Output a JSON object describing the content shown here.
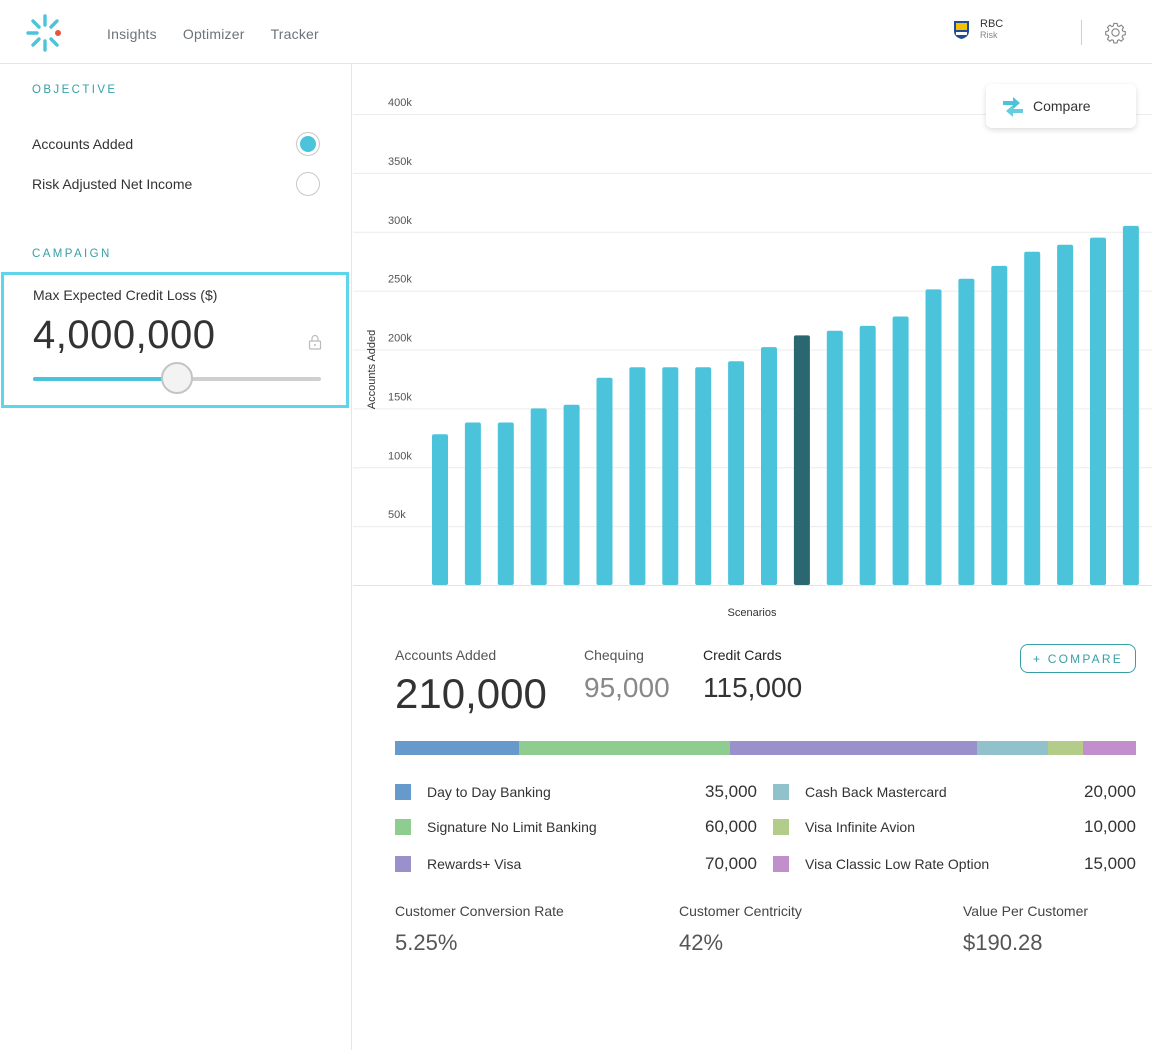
{
  "nav": {
    "items": [
      "Insights",
      "Optimizer",
      "Tracker"
    ]
  },
  "org": {
    "name": "RBC",
    "role": "Risk"
  },
  "icons": {
    "logo": "sparkle-logo",
    "org_logo": "rbc-shield-logo",
    "settings": "gear-icon",
    "lock": "lock-icon",
    "compare": "swap-arrows-icon"
  },
  "colors": {
    "accent": "#4bc3da",
    "accent_dark": "#2b6770",
    "teal_text": "#35a0a7"
  },
  "sidebar": {
    "objective_title": "OBJECTIVE",
    "objectives": [
      {
        "label": "Accounts Added",
        "selected": true
      },
      {
        "label": "Risk Adjusted Net Income",
        "selected": false
      }
    ],
    "campaign_title": "CAMPAIGN",
    "campaign": {
      "label": "Max Expected Credit Loss ($)",
      "value": "4,000,000",
      "slider_fraction": 0.5
    }
  },
  "compare_card": {
    "label": "Compare"
  },
  "chart_data": {
    "type": "bar",
    "ylabel": "Accounts Added",
    "xlabel": "Scenarios",
    "ylim": [
      0,
      400000
    ],
    "yticks": [
      50000,
      100000,
      150000,
      200000,
      250000,
      300000,
      350000,
      400000
    ],
    "ytick_labels": [
      "50k",
      "100k",
      "150k",
      "200k",
      "250k",
      "300k",
      "350k",
      "400k"
    ],
    "grid": true,
    "highlight_index": 11,
    "values": [
      128000,
      138000,
      138000,
      150000,
      153000,
      176000,
      185000,
      185000,
      185000,
      190000,
      202000,
      212000,
      216000,
      220000,
      228000,
      251000,
      260000,
      271000,
      283000,
      289000,
      295000,
      305000
    ]
  },
  "summary": {
    "accounts_added_label": "Accounts Added",
    "accounts_added_value": "210,000",
    "chequing_label": "Chequing",
    "chequing_value": "95,000",
    "credit_cards_label": "Credit Cards",
    "credit_cards_value": "115,000",
    "compare_button": "+ COMPARE"
  },
  "breakdown": [
    {
      "name": "Day to Day Banking",
      "value": "35,000",
      "amount": 35000,
      "color": "#6699cc"
    },
    {
      "name": "Signature No Limit Banking",
      "value": "60,000",
      "amount": 60000,
      "color": "#8fcc8f"
    },
    {
      "name": "Rewards+ Visa",
      "value": "70,000",
      "amount": 70000,
      "color": "#9990cc"
    },
    {
      "name": "Cash Back Mastercard",
      "value": "20,000",
      "amount": 20000,
      "color": "#91c2cc"
    },
    {
      "name": "Visa Infinite Avion",
      "value": "10,000",
      "amount": 10000,
      "color": "#b3cc8a"
    },
    {
      "name": "Visa Classic Low Rate Option",
      "value": "15,000",
      "amount": 15000,
      "color": "#c08fcc"
    }
  ],
  "kpis": [
    {
      "label": "Customer Conversion Rate",
      "value": "5.25%"
    },
    {
      "label": "Customer Centricity",
      "value": "42%"
    },
    {
      "label": "Value Per Customer",
      "value": "$190.28"
    }
  ]
}
